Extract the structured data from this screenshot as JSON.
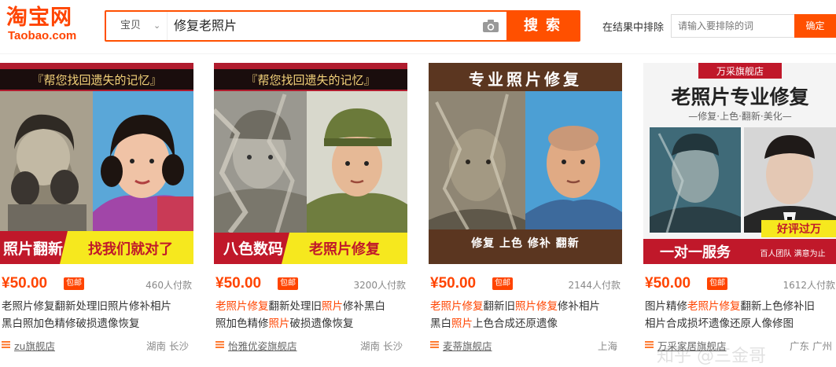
{
  "header": {
    "logo_cn": "淘宝网",
    "logo_en": "Taobao.com",
    "scope": "宝贝",
    "query": "修复老照片",
    "search_button": "搜索",
    "exclude_label": "在结果中排除",
    "exclude_placeholder": "请输入要排除的词",
    "exclude_button": "确定"
  },
  "items": [
    {
      "banner_top": "『帮您找回遗失的记忆』",
      "banner_left": "照片翻新",
      "banner_right": "找我们就对了",
      "price": "¥50.00",
      "badge": "包邮",
      "sold": "460人付款",
      "title_line1": "老照片修复翻新处理旧照片修补相片",
      "title_line2": "黑白照加色精修破损遗像恢复",
      "shop": "zu旗舰店",
      "location": "湖南 长沙"
    },
    {
      "banner_top": "『帮您找回遗失的记忆』",
      "banner_left": "八色数码",
      "banner_right": "老照片修复",
      "price": "¥50.00",
      "badge": "包邮",
      "sold": "3200人付款",
      "title_seg1": "老照片修复",
      "title_seg2": "翻新处理旧",
      "title_seg3": "照片",
      "title_seg4": "修补黑白",
      "title_seg5": "照加色精修",
      "title_seg6": "照片",
      "title_seg7": "破损遗像恢复",
      "shop": "怡雅优姿旗舰店",
      "location": "湖南 长沙"
    },
    {
      "banner_top": "专业照片修复",
      "banner_bottom": "修复  上色  修补  翻新",
      "price": "¥50.00",
      "badge": "包邮",
      "sold": "2144人付款",
      "title_seg1": "老照片修复",
      "title_seg2": "翻新旧",
      "title_seg3": "照片修复",
      "title_seg4": "修补相片",
      "title_seg5": "黑白",
      "title_seg6": "照片",
      "title_seg7": "上色合成还原遗像",
      "shop": "麦蒂旗舰店",
      "location": "上海"
    },
    {
      "banner_store": "万采旗舰店",
      "banner_title": "老照片专业修复",
      "banner_sub": "—修复·上色·翻新·美化—",
      "banner_ribbon": "好评过万",
      "banner_bottom": "一对一服务",
      "banner_note": "百人团队 满意为止",
      "price": "¥50.00",
      "badge": "包邮",
      "sold": "1612人付款",
      "title_seg1": "图片精修",
      "title_seg2": "老照片修复",
      "title_seg3": "翻新上色修补旧",
      "title_line2": "相片合成损坏遗像还原人像修图",
      "shop": "万采家居旗舰店",
      "location": "广东 广州"
    }
  ],
  "watermark": "知乎 @三金哥",
  "colors": {
    "accent": "#ff5000",
    "price": "#ff4400"
  }
}
